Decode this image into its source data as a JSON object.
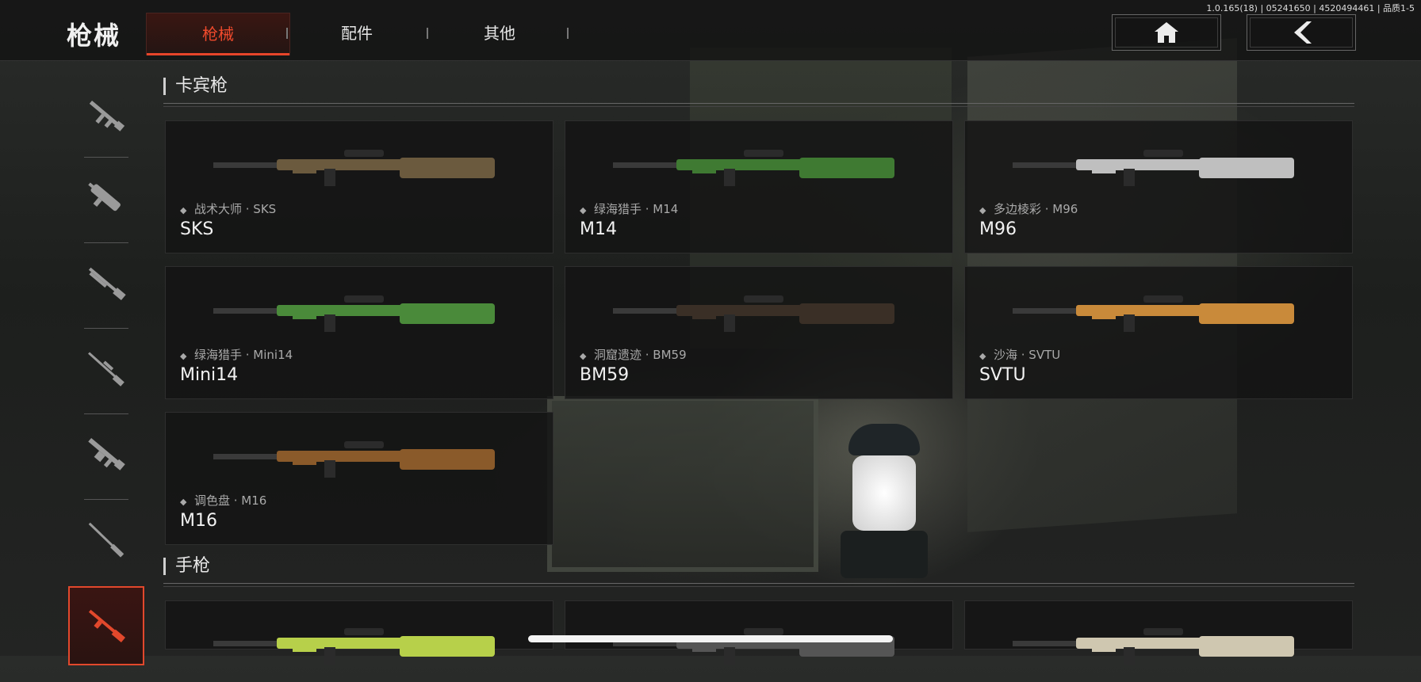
{
  "header": {
    "title": "枪械",
    "build": "1.0.165(18) | 05241650 | 4520494461 | 品质1-5",
    "tabs": [
      {
        "label": "枪械",
        "active": true
      },
      {
        "label": "配件",
        "active": false
      },
      {
        "label": "其他",
        "active": false
      }
    ],
    "home_icon": "home-icon",
    "back_icon": "chevron-left-icon"
  },
  "sidebar": {
    "items": [
      {
        "icon": "assault-rifle-icon",
        "active": false
      },
      {
        "icon": "smg-icon",
        "active": false
      },
      {
        "icon": "shotgun-icon",
        "active": false
      },
      {
        "icon": "sniper-rifle-icon",
        "active": false
      },
      {
        "icon": "lmg-icon",
        "active": false
      },
      {
        "icon": "marksman-rifle-icon",
        "active": false
      },
      {
        "icon": "carbine-icon",
        "active": true
      }
    ],
    "accent": "#e2482c"
  },
  "sections": [
    {
      "title": "卡宾枪",
      "cards": [
        {
          "skin": "战术大师 · SKS",
          "name": "SKS",
          "color": "#6b5a3e"
        },
        {
          "skin": "绿海猎手 · M14",
          "name": "M14",
          "color": "#3f7a32"
        },
        {
          "skin": "多边棱彩 · M96",
          "name": "M96",
          "color": "#bfbfbf"
        },
        {
          "skin": "绿海猎手 · Mini14",
          "name": "Mini14",
          "color": "#4a8a3a"
        },
        {
          "skin": "洞窟遗迹 · BM59",
          "name": "BM59",
          "color": "#3a2f26"
        },
        {
          "skin": "沙海 · SVTU",
          "name": "SVTU",
          "color": "#c98a3a"
        },
        {
          "skin": "调色盘 · M16",
          "name": "M16",
          "color": "#8a5a2a"
        }
      ]
    },
    {
      "title": "手枪",
      "cards": [
        {
          "skin": "",
          "name": "",
          "color": "#b7d04a"
        },
        {
          "skin": "",
          "name": "",
          "color": "#555555"
        },
        {
          "skin": "",
          "name": "",
          "color": "#cfc7b0"
        }
      ]
    }
  ]
}
